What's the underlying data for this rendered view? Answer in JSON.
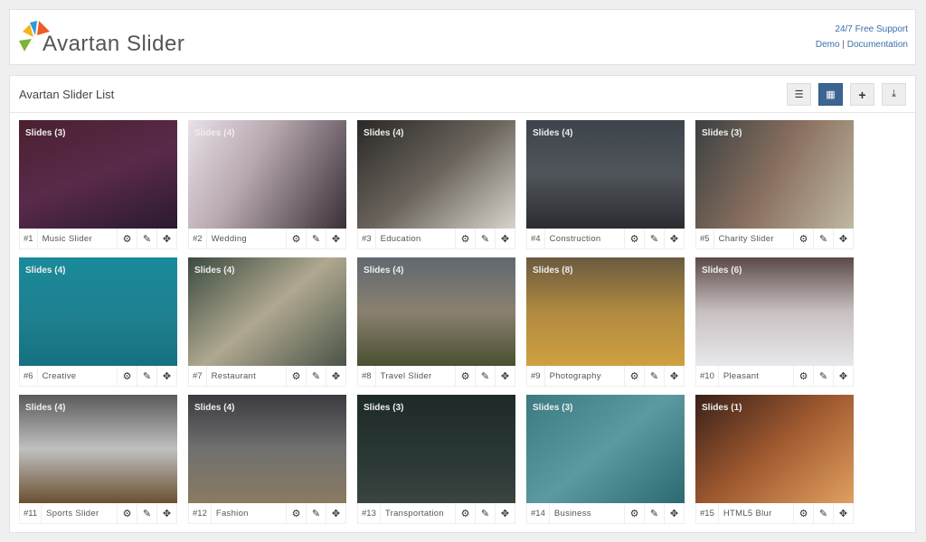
{
  "header": {
    "brand": "Avartan Slider",
    "support": "24/7 Free Support",
    "demo": "Demo",
    "sep": "|",
    "docs": "Documentation"
  },
  "list": {
    "title": "Avartan Slider List"
  },
  "colors": {
    "accent": "#3d6593"
  },
  "sliders": [
    {
      "num": "#1",
      "name": "Music Slider",
      "slides": "Slides (3)",
      "bg": "linear-gradient(160deg,#4a2030,#5a2a4a 50%,#2a1a30)"
    },
    {
      "num": "#2",
      "name": "Wedding",
      "slides": "Slides (4)",
      "bg": "linear-gradient(120deg,#e8e0e8,#b8a8b0 40%,#3a3038)"
    },
    {
      "num": "#3",
      "name": "Education",
      "slides": "Slides (4)",
      "bg": "linear-gradient(140deg,#2a2826,#6a645c 50%,#d8d4cc)"
    },
    {
      "num": "#4",
      "name": "Construction",
      "slides": "Slides (4)",
      "bg": "linear-gradient(180deg,#3e444c,#50555a 50%,#2a2c30)"
    },
    {
      "num": "#5",
      "name": "Charity Slider",
      "slides": "Slides (3)",
      "bg": "linear-gradient(120deg,#3a4040,#8a7060 50%,#c0b8a0)"
    },
    {
      "num": "#6",
      "name": "Creative",
      "slides": "Slides (4)",
      "bg": "linear-gradient(180deg,#1a8a9a,#1e7f8f 60%,#157080)"
    },
    {
      "num": "#7",
      "name": "Restaurant",
      "slides": "Slides (4)",
      "bg": "linear-gradient(140deg,#3a4a40,#b0a890 50%,#4a5448)"
    },
    {
      "num": "#8",
      "name": "Travel Slider",
      "slides": "Slides (4)",
      "bg": "linear-gradient(180deg,#606870,#8a8070 50%,#4a5030)"
    },
    {
      "num": "#9",
      "name": "Photography",
      "slides": "Slides (8)",
      "bg": "linear-gradient(180deg,#6a5a40,#b08a40 50%,#d0a040)"
    },
    {
      "num": "#10",
      "name": "Pleasant",
      "slides": "Slides (6)",
      "bg": "linear-gradient(180deg,#5a4a48,#c8c0c0 50%,#e8e8ec)"
    },
    {
      "num": "#11",
      "name": "Sports Slider",
      "slides": "Slides (4)",
      "bg": "linear-gradient(180deg,#5a5a5a,#c0c0c0 50%,#6a5030)"
    },
    {
      "num": "#12",
      "name": "Fashion",
      "slides": "Slides (4)",
      "bg": "linear-gradient(180deg,#3a3a40,#707070 50%,#8a7a60)"
    },
    {
      "num": "#13",
      "name": "Transportation",
      "slides": "Slides (3)",
      "bg": "linear-gradient(180deg,#1e2a28,#2a3836 60%,#3a4440)"
    },
    {
      "num": "#14",
      "name": "Business",
      "slides": "Slides (3)",
      "bg": "linear-gradient(140deg,#3a7a80,#5a9aa0 50%,#2a6a70)"
    },
    {
      "num": "#15",
      "name": "HTML5 Blur",
      "slides": "Slides (1)",
      "bg": "linear-gradient(140deg,#3a2018,#a05a30 50%,#e0a060)"
    }
  ]
}
